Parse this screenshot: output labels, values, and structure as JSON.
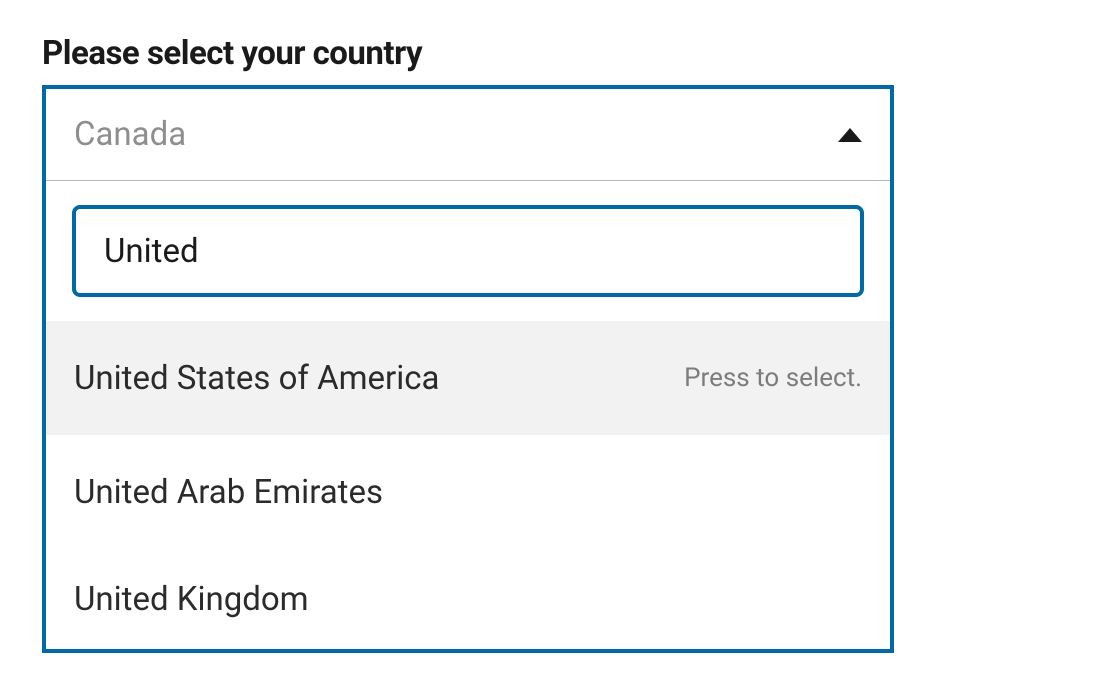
{
  "label": "Please select your country",
  "placeholder": "Canada",
  "search_value": "United",
  "select_hint": "Press to select.",
  "options": [
    {
      "label": "United States of America",
      "highlighted": true
    },
    {
      "label": "United Arab Emirates",
      "highlighted": false
    },
    {
      "label": "United Kingdom",
      "highlighted": false
    }
  ]
}
